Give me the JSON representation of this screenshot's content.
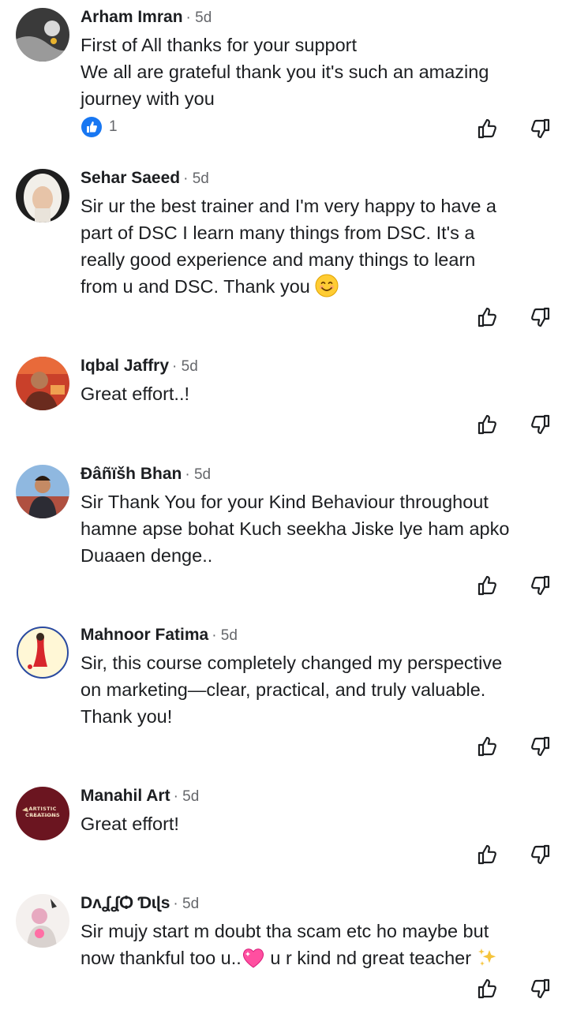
{
  "comments": [
    {
      "name": "Arham Imran",
      "time": "5d",
      "lines": [
        "First of All thanks for your support",
        "We all are grateful thank you it's such an amazing",
        "journey with you"
      ],
      "reaction_count": "1"
    },
    {
      "name": "Sehar Saeed",
      "time": "5d",
      "lines": [
        "Sir ur the best trainer and I'm very happy to have a",
        "part of DSC I learn many things from DSC. It's a",
        "really good experience and many things to learn",
        "from u and DSC. Thank you"
      ]
    },
    {
      "name": "Iqbal Jaffry",
      "time": "5d",
      "lines": [
        "Great effort..!"
      ]
    },
    {
      "name": "Đâñïšh Bhan",
      "time": "5d",
      "lines": [
        "Sir Thank You for your Kind Behaviour throughout",
        "hamne apse bohat Kuch seekha Jiske lye ham apko",
        "Duaaen denge.."
      ]
    },
    {
      "name": "Mahnoor Fatima",
      "time": "5d",
      "lines": [
        "Sir, this course completely changed my perspective",
        "on marketing—clear, practical, and truly valuable.",
        "Thank you!"
      ]
    },
    {
      "name": "Manahil Art",
      "time": "5d",
      "lines": [
        "Great effort!"
      ],
      "avatar_text": [
        "ARTISTIC",
        "CREATIONS"
      ]
    },
    {
      "name": "DʌʆʆѺ Ɗɩɭs",
      "time": "5d",
      "lines": [
        "Sir mujy start m doubt tha scam etc ho maybe but",
        "now thankful too u.."
      ],
      "line2_suffix": "u r kind nd great teacher"
    }
  ],
  "icons": {
    "like": "thumbs-up-icon",
    "dislike": "thumbs-down-icon",
    "reaction": "like-reaction-icon"
  },
  "colors": {
    "brand_blue": "#1877f2",
    "meta_gray": "#65676b"
  }
}
